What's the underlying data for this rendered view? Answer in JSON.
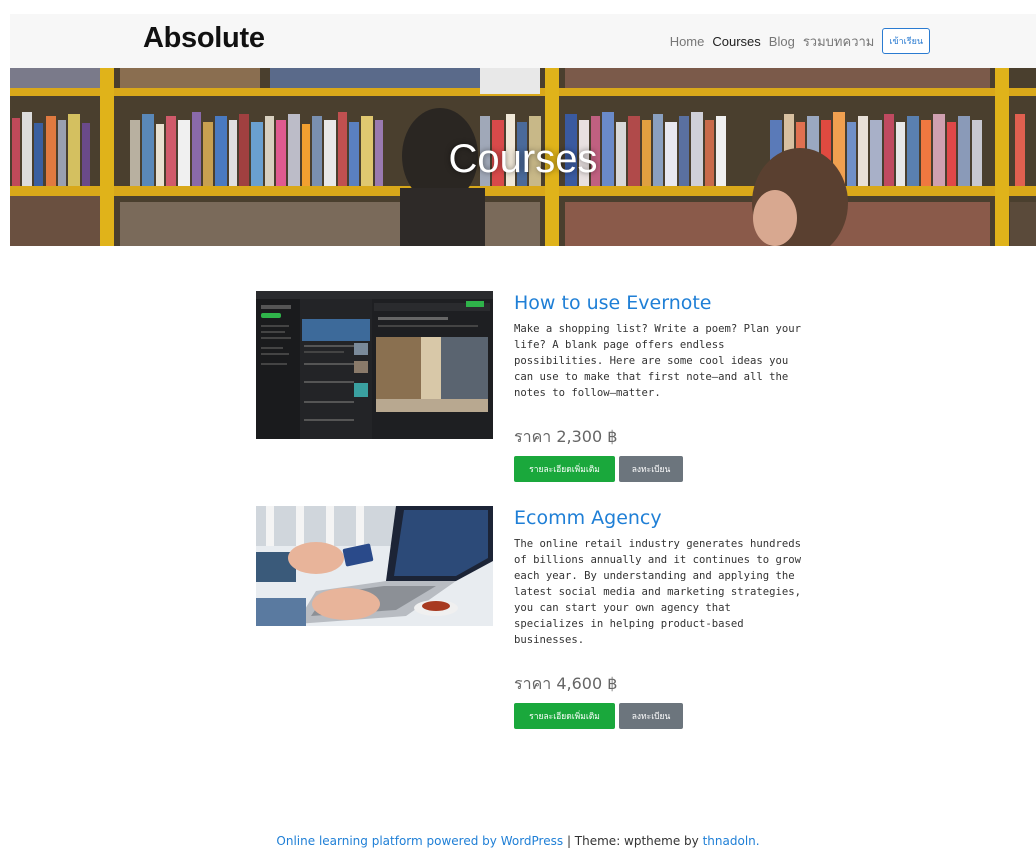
{
  "header": {
    "brand": "Absolute",
    "nav": [
      "Home",
      "Courses",
      "Blog",
      "รวมบทความ"
    ],
    "active_nav": "Courses",
    "login_button": "เข้าเรียน"
  },
  "hero": {
    "title": "Courses"
  },
  "courses": [
    {
      "title": "How to use Evernote",
      "description": "Make a shopping list? Write a poem? Plan your life? A blank page offers endless possibilities. Here are some cool ideas you can use to make that first note—and all the notes to follow—matter.",
      "price": "ราคา 2,300 ฿",
      "details_button": "รายละเอียดเพิ่มเติม",
      "register_button": "ลงทะเบียน"
    },
    {
      "title": "Ecomm Agency",
      "description": "The online retail industry generates hundreds of billions annually and it continues to grow each year. By understanding and applying the latest social media and marketing strategies, you can start your own agency that specializes in helping product-based businesses.",
      "price": "ราคา 4,600 ฿",
      "details_button": "รายละเอียดเพิ่มเติม",
      "register_button": "ลงทะเบียน"
    }
  ],
  "footer": {
    "platform_link": "Online learning platform powered by WordPress",
    "separator": " | Theme: wptheme by ",
    "author_link": "thnadoln."
  },
  "colors": {
    "link_blue": "#1f7fd6",
    "button_green": "#1aa83c",
    "button_gray": "#6c757d",
    "shelf_yellow": "#e0b31a"
  }
}
